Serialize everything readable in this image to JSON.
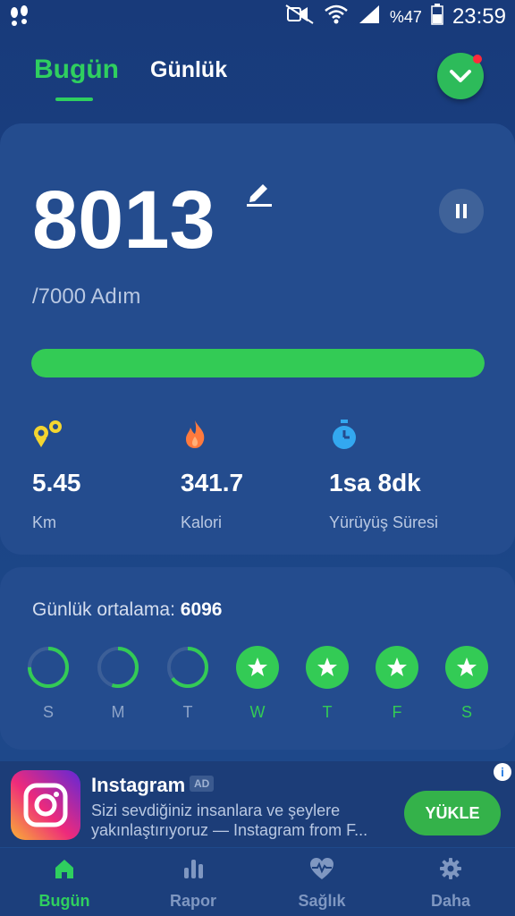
{
  "status_bar": {
    "battery_pct": "%47",
    "time": "23:59",
    "icons": [
      "app-footsteps-icon",
      "mute-icon",
      "wifi-icon",
      "signal-icon",
      "battery-icon"
    ]
  },
  "tabs": {
    "today": "Bugün",
    "daily": "Günlük"
  },
  "steps": {
    "count": "8013",
    "goal_text": "/7000 Adım",
    "progress_fraction": 1.0
  },
  "stats": [
    {
      "icon": "distance-icon",
      "value": "5.45",
      "label": "Km"
    },
    {
      "icon": "flame-icon",
      "value": "341.7",
      "label": "Kalori"
    },
    {
      "icon": "stopwatch-icon",
      "value": "1sa 8dk",
      "label": "Yürüyüş Süresi"
    }
  ],
  "daily_average": {
    "label": "Günlük ortalama:",
    "value": "6096"
  },
  "week": [
    {
      "day": "S",
      "progress": 0.75,
      "done": false
    },
    {
      "day": "M",
      "progress": 0.55,
      "done": false
    },
    {
      "day": "T",
      "progress": 0.65,
      "done": false
    },
    {
      "day": "W",
      "progress": 1.0,
      "done": true
    },
    {
      "day": "T",
      "progress": 1.0,
      "done": true
    },
    {
      "day": "F",
      "progress": 1.0,
      "done": true
    },
    {
      "day": "S",
      "progress": 1.0,
      "done": true
    }
  ],
  "ad": {
    "title": "Instagram",
    "badge": "AD",
    "text": "Sizi sevdiğiniz insanlara ve şeylere yakınlaştırıyoruz — Instagram from F...",
    "button": "YÜKLE"
  },
  "nav": [
    {
      "label": "Bugün",
      "icon": "home-icon",
      "active": true
    },
    {
      "label": "Rapor",
      "icon": "bar-chart-icon",
      "active": false
    },
    {
      "label": "Sağlık",
      "icon": "heart-pulse-icon",
      "active": false
    },
    {
      "label": "Daha",
      "icon": "gear-icon",
      "active": false
    }
  ],
  "colors": {
    "accent": "#2fcf5f",
    "card": "#244c8e",
    "background": "#1b4384"
  }
}
